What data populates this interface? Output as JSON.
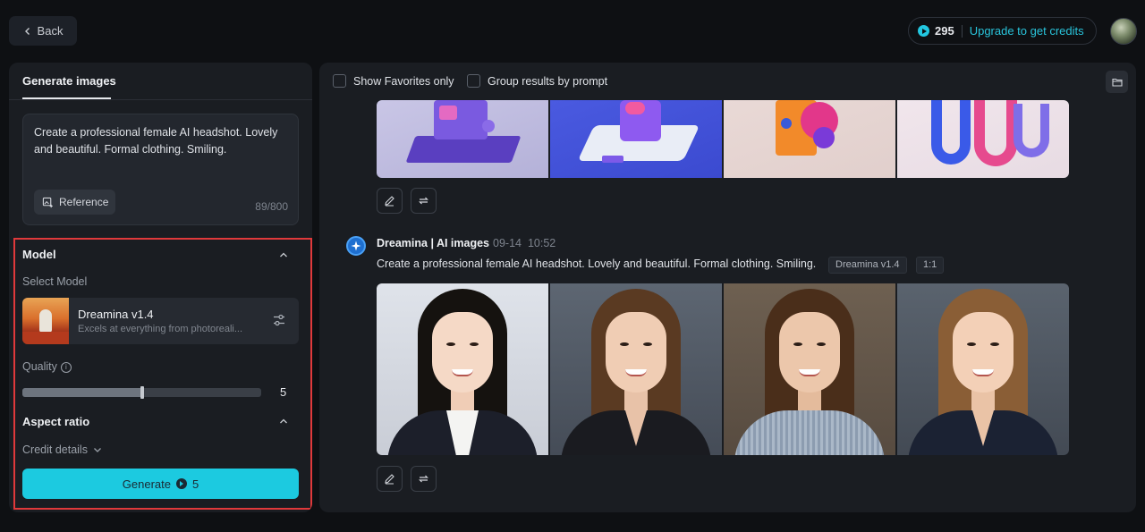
{
  "topbar": {
    "back_label": "Back",
    "credits": "295",
    "upgrade_label": "Upgrade to get credits"
  },
  "left": {
    "tab": "Generate images",
    "prompt": "Create a professional female AI headshot. Lovely and beautiful. Formal clothing. Smiling.",
    "reference_label": "Reference",
    "char_count": "89/800",
    "model_section": "Model",
    "select_model_label": "Select Model",
    "model_name": "Dreamina v1.4",
    "model_desc": "Excels at everything from photoreali...",
    "quality_label": "Quality",
    "quality_value": "5",
    "quality_fraction": 0.5,
    "aspect_ratio_label": "Aspect ratio",
    "credit_details_label": "Credit details",
    "generate_label": "Generate",
    "generate_cost": "5"
  },
  "right": {
    "show_favorites_label": "Show Favorites only",
    "group_results_label": "Group results by prompt",
    "bot_name": "Dreamina | AI images",
    "date": "09-14",
    "time": "10:52",
    "prompt": "Create a professional female AI headshot. Lovely and beautiful. Formal clothing. Smiling.",
    "model_tag": "Dreamina v1.4",
    "ratio_tag": "1:1"
  },
  "colors": {
    "accent": "#1ccae0",
    "highlight_border": "#e0393b",
    "panel": "#1a1d22",
    "background": "#0e1013"
  }
}
